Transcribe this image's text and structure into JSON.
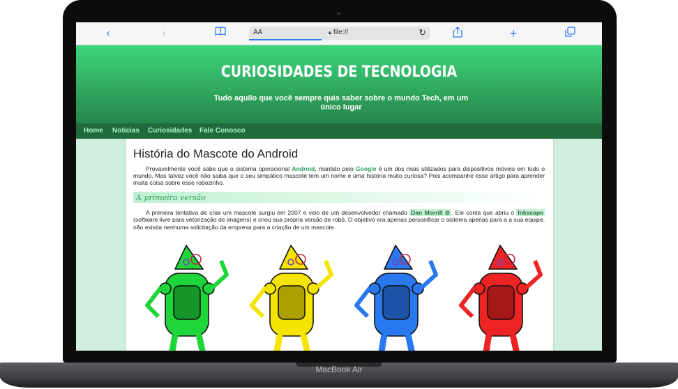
{
  "browser": {
    "address_aa": "AA",
    "url": "file://",
    "icons": [
      "back-icon",
      "forward-icon",
      "bookmarks-icon",
      "lock-icon",
      "reload-icon",
      "share-icon",
      "new-tab-icon",
      "tabs-icon"
    ]
  },
  "device": {
    "label": "MacBook Air"
  },
  "site": {
    "title": "CURIOSIDADES DE TECNOLOGIA",
    "subtitle": "Tudo aquilo que você sempre quis saber sobre o mundo Tech, em um único lugar",
    "nav": [
      "Home",
      "Notícias",
      "Curiosidades",
      "Fale Conosco"
    ]
  },
  "article": {
    "title": "História do Mascote do Android",
    "p1": {
      "a": "Provavelmente você sabe que o sistema operacional ",
      "android": "Android",
      "b": ", mantido pelo ",
      "google": "Google",
      "c": " é um dos mais utilizados para dispositivos móveis em todo o mundo. Mas talvez você não saiba que o seu simpático mascote tem um nome e uma história muito curiosa? Pois acompanhe esse artigo para aprender muita coisa sobre esse robozinho."
    },
    "section": "A primeira versão",
    "p2": {
      "a": "A primeira tentativa de criar um mascote surgiu em 2007 e veio de um desenvolvedor chamado ",
      "dan": "Dan Morrill",
      "b": ". Ele conta que abriu o ",
      "inkscape": "Inkscape",
      "c": " (software livre para vetorização de imagens) e criou sua própria versão de robô. O objetivo era apenas personificar o sistema apenas para a a sua equipe, não existia nenhuma solicitação da empresa para a criação de um mascote."
    },
    "robot_colors": [
      "#1fd63a",
      "#f5e400",
      "#2a78f0",
      "#ee2424"
    ]
  },
  "colors": {
    "accent": "#2e9c57",
    "header_top": "#3ed67c",
    "header_bottom": "#26854a",
    "nav": "#1f6b3c",
    "page_bg": "#cfeedd"
  }
}
